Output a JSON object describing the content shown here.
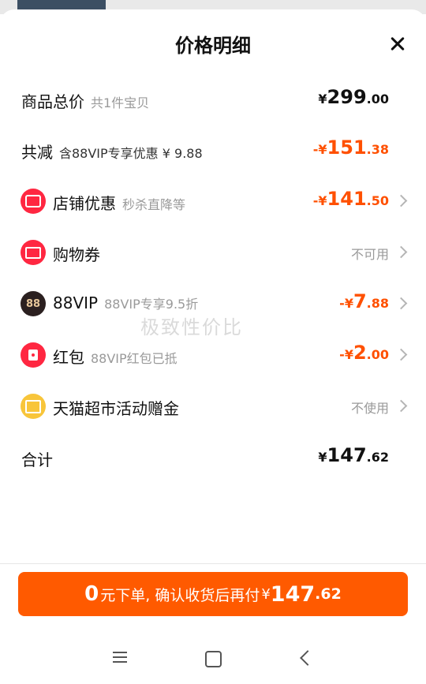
{
  "title": "价格明细",
  "watermark": "极致性价比",
  "rows": {
    "total": {
      "label": "商品总价",
      "sub": "共1件宝贝",
      "yen": "¥",
      "big": "299",
      "small": ".00"
    },
    "reduce": {
      "label": "共减",
      "sub": "含88VIP专享优惠 ¥ 9.88",
      "yen": "-¥",
      "big": "151",
      "small": ".38"
    },
    "shop": {
      "label": "店铺优惠",
      "sub": "秒杀直降等",
      "yen": "-¥",
      "big": "141",
      "small": ".50",
      "icon": "shop-icon"
    },
    "coupon": {
      "label": "购物券",
      "status": "不可用",
      "icon": "ticket-icon"
    },
    "vip": {
      "label": "88VIP",
      "sub": "88VIP专享9.5折",
      "yen": "-¥",
      "big": "7",
      "small": ".88",
      "badge": "88"
    },
    "redpacket": {
      "label": "红包",
      "sub": "88VIP红包已抵",
      "yen": "-¥",
      "big": "2",
      "small": ".00",
      "icon": "red-envelope-icon"
    },
    "gift": {
      "label": "天猫超市活动赠金",
      "status": "不使用",
      "icon": "gift-icon"
    },
    "sum": {
      "label": "合计",
      "yen": "¥",
      "big": "147",
      "small": ".62"
    }
  },
  "cta": {
    "num": "0",
    "text": "元下单, 确认收货后再付",
    "yen": "¥",
    "big": "147",
    "small": ".62"
  },
  "colors": {
    "accent": "#ff5000",
    "cta": "#ff5a00",
    "icon_red": "#ff2741",
    "icon_yellow": "#f8c53a"
  }
}
